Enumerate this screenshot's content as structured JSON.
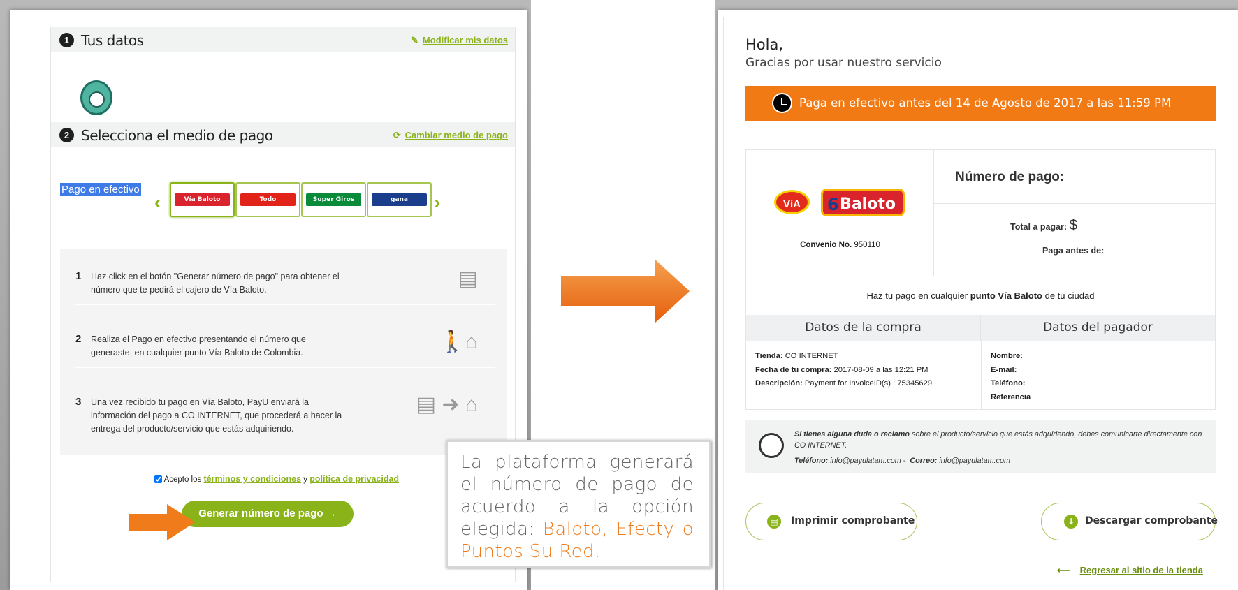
{
  "left": {
    "section1": {
      "num": "1",
      "title": "Tus datos",
      "link": "Modificar mis datos"
    },
    "section2": {
      "num": "2",
      "title": "Selecciona el medio de pago",
      "link": "Cambiar medio de pago"
    },
    "cash_label": "Pago en efectivo",
    "providers": [
      {
        "name": "Vía Baloto",
        "color": "#d9232d"
      },
      {
        "name": "Todo",
        "color": "#e2231a"
      },
      {
        "name": "Super Giros",
        "color": "#0a8b3a"
      },
      {
        "name": "gana",
        "color": "#1a3e8c"
      }
    ],
    "steps": [
      {
        "num": "1",
        "text": "Haz click en el botón \"Generar número de pago\" para obtener el número que te pedirá el cajero de Vía Baloto.",
        "icon": "receipt-icon"
      },
      {
        "num": "2",
        "text": "Realiza el Pago en efectivo presentando el número que generaste, en cualquier punto Vía Baloto de Colombia.",
        "icon": "walk-to-store-icon"
      },
      {
        "num": "3",
        "text": "Una vez recibido tu pago en Vía Baloto, PayU enviará la información del pago a CO INTERNET, que procederá a hacer la entrega del producto/servicio que estás adquiriendo.",
        "icon": "receipt-to-store-icon"
      }
    ],
    "terms": {
      "prefix": "Acepto los",
      "terms_link": "términos y condiciones",
      "and": "y",
      "privacy_link": "política de privacidad"
    },
    "generate_button": "Generar número de pago →"
  },
  "callout": {
    "text_before": "La plataforma generará el número de pago de acuerdo a la opción elegida: ",
    "highlight": "Baloto, Efecty o Puntos Su Red."
  },
  "right": {
    "greeting": "Hola,",
    "thanks": "Gracias por usar nuestro servicio",
    "deadline_banner": "Paga en efectivo antes del 14 de Agosto de 2017 a las 11:59 PM",
    "logo_via": "VíA",
    "logo_baloto": "Baloto",
    "logo_baloto_six": "6",
    "agreement_label": "Convenio No.",
    "agreement_number": "950110",
    "payment_number_label": "Número de pago:",
    "total_label": "Total a pagar:",
    "currency": "$",
    "pay_before_label": "Paga antes de:",
    "where_prefix": "Haz tu pago en cualquier",
    "where_bold": "punto Vía Baloto",
    "where_suffix": "de tu ciudad",
    "purchase_header": "Datos de la compra",
    "payer_header": "Datos del pagador",
    "purchase": [
      {
        "label": "Tienda:",
        "value": "CO INTERNET"
      },
      {
        "label": "Fecha de tu compra:",
        "value": "2017-08-09 a las 12:21 PM"
      },
      {
        "label": "Descripción:",
        "value": "Payment for InvoiceID(s) : 75345629"
      }
    ],
    "payer": [
      {
        "label": "Nombre:",
        "value": ""
      },
      {
        "label": "E-mail:",
        "value": ""
      },
      {
        "label": "Teléfono:",
        "value": ""
      },
      {
        "label": "Referencia",
        "value": ""
      }
    ],
    "support": {
      "bold_intro": "Si tienes alguna duda o reclamo",
      "text": "sobre el producto/servicio que estás adquiriendo, debes comunicarte directamente con CO INTERNET.",
      "phone_label": "Teléfono:",
      "phone_value": "info@payulatam.com -",
      "email_label": "Correo:",
      "email_value": "info@payulatam.com"
    },
    "print_button": "Imprimir comprobante",
    "download_button": "Descargar comprobante",
    "back_arrow": "⟵",
    "back_link": "Regresar al sitio de la tienda"
  },
  "colors": {
    "green": "#8ab31a",
    "orange": "#f27a14"
  }
}
